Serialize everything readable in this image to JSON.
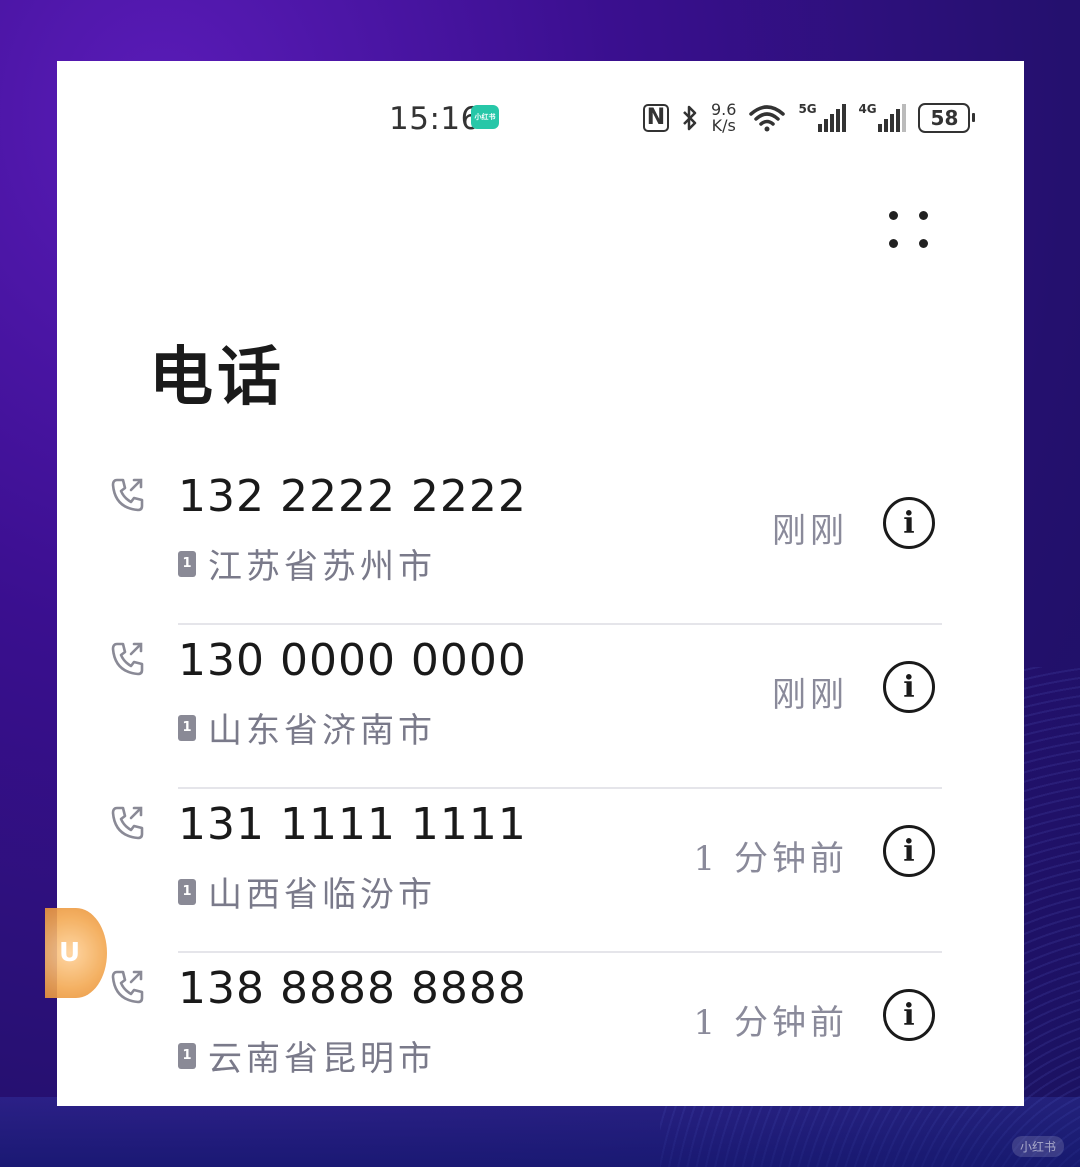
{
  "status_bar": {
    "time": "15:16",
    "app_badge": "小红书",
    "nfc": "N",
    "speed_value": "9.6",
    "speed_unit": "K/s",
    "sim1_network": "5G",
    "sim2_network": "4G",
    "battery": "58"
  },
  "page": {
    "title": "电话"
  },
  "calls": [
    {
      "number": "132 2222 2222",
      "location": "江苏省苏州市",
      "sim": "1",
      "time": "刚刚"
    },
    {
      "number": "130 0000 0000",
      "location": "山东省济南市",
      "sim": "1",
      "time": "刚刚"
    },
    {
      "number": "131 1111 1111",
      "location": "山西省临汾市",
      "sim": "1",
      "time": "1 分钟前"
    },
    {
      "number": "138 8888 8888",
      "location": "云南省昆明市",
      "sim": "1",
      "time": "1 分钟前"
    }
  ],
  "icons": {
    "info": "i",
    "call_type": "outgoing-call-icon",
    "more": "more-dots-icon"
  },
  "watermark": "小红书",
  "colors": {
    "background": "#3a0f8f",
    "accent_float": "#f3a953"
  }
}
